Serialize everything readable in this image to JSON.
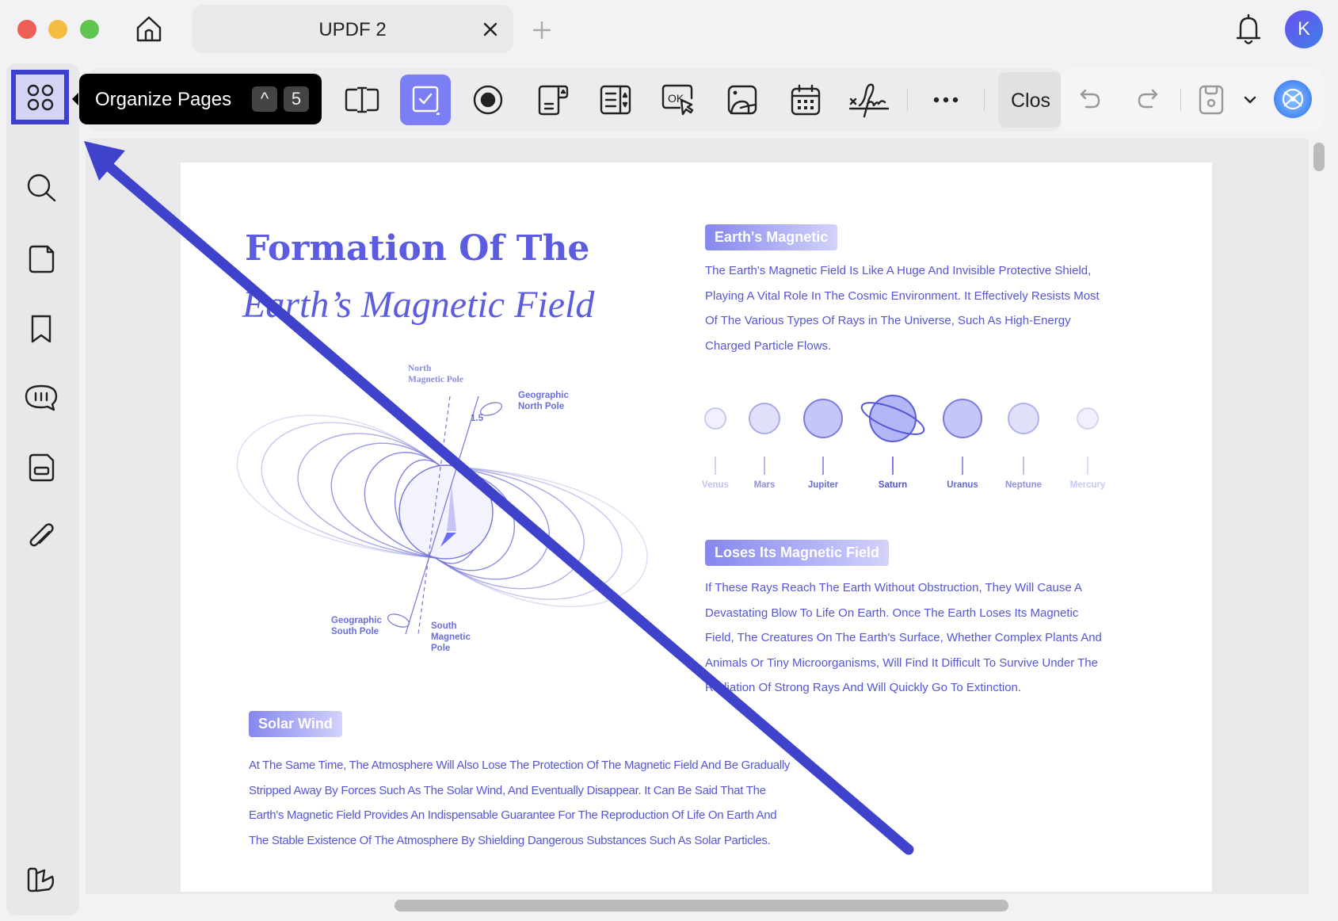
{
  "window": {
    "traffic_lights": {
      "close": "#ee5f57",
      "minimize": "#f5bd3f",
      "zoom": "#5fc550"
    }
  },
  "tabs": [
    {
      "label": "UPDF 2",
      "close_icon": "x-icon"
    }
  ],
  "new_tab_icon": "plus-icon",
  "user": {
    "avatar_letter": "K",
    "avatar_color": "#5a55e6"
  },
  "tooltip": {
    "label": "Organize Pages",
    "shortcut_modifier": "^",
    "shortcut_key": "5"
  },
  "toolbar": {
    "close_label": "Clos",
    "active_tool": "checkbox",
    "accent": "#7b7ef5",
    "tools": [
      "text-field",
      "checkbox",
      "radio-button",
      "combo-box",
      "list-box",
      "button",
      "image",
      "date",
      "signature",
      "more"
    ]
  },
  "sidebar": {
    "items": [
      "organize-pages",
      "search",
      "thumbnails",
      "bookmark",
      "comment",
      "form",
      "attachment",
      "theme"
    ]
  },
  "document": {
    "title_line1": "Formation Of The",
    "title_line2": "Earth’s Magnetic Field",
    "diagram": {
      "north_magnetic_pole": [
        "North",
        "Magnetic Pole"
      ],
      "geographic_north_pole": [
        "Geographic",
        "North Pole"
      ],
      "angle": "1.5",
      "geographic_south_pole": [
        "Geographic",
        "South Pole"
      ],
      "south_magnetic_pole": [
        "South",
        "Magnetic",
        "Pole"
      ]
    },
    "section1": {
      "heading": "Earth's Magnetic",
      "lines": [
        "The Earth's Magnetic Field Is Like A Huge And Invisible Protective Shield,",
        "Playing A Vital Role In The Cosmic Environment. It Effectively Resists Most",
        "Of The Various Types Of Rays in The Universe, Such As High-Energy",
        "Charged Particle Flows."
      ]
    },
    "planets": [
      "Venus",
      "Mars",
      "Jupiter",
      "Saturn",
      "Uranus",
      "Neptune",
      "Mercury"
    ],
    "section2": {
      "heading": "Loses Its Magnetic Field",
      "lines": [
        "If These Rays Reach The Earth Without Obstruction, They Will Cause A",
        "Devastating Blow To Life On Earth. Once The Earth Loses Its Magnetic",
        "Field, The Creatures On The Earth's Surface, Whether Complex Plants And",
        "Animals Or Tiny Microorganisms, Will Find It Difficult To Survive Under The",
        "Radiation Of Strong Rays And Will Quickly Go To Extinction."
      ]
    },
    "section3": {
      "heading": "Solar Wind",
      "lines": [
        "At The Same Time, The Atmosphere Will Also Lose The Protection Of The Magnetic Field And Be Gradually",
        "Stripped Away By Forces Such As The Solar Wind, And Eventually Disappear. It Can Be Said That The",
        "Earth's Magnetic Field Provides An Indispensable Guarantee For The Reproduction Of Life On Earth And",
        "The Stable Existence Of The Atmosphere By Shielding Dangerous Substances Such As Solar Particles."
      ]
    }
  },
  "annotation": {
    "arrow_color": "#3f43cc"
  }
}
